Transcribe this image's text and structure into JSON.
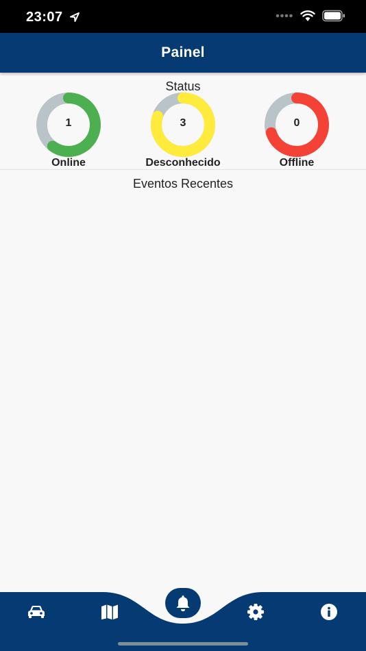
{
  "status_bar": {
    "time": "23:07",
    "icons": [
      "location-arrow-icon",
      "signal-dots-icon",
      "wifi-icon",
      "battery-icon"
    ]
  },
  "app_bar": {
    "title": "Painel"
  },
  "status": {
    "heading": "Status",
    "items": [
      {
        "label": "Online",
        "value": "1",
        "color": "#4caf50",
        "fraction": 0.6
      },
      {
        "label": "Desconhecido",
        "value": "3",
        "color": "#ffeb3b",
        "fraction": 0.8
      },
      {
        "label": "Offline",
        "value": "0",
        "color": "#f44336",
        "fraction": 0.7
      }
    ],
    "track_color": "#b8c4c8"
  },
  "events": {
    "heading": "Eventos Recentes"
  },
  "bottom_nav": {
    "items": [
      "car-icon",
      "map-icon",
      "bell-icon",
      "gear-icon",
      "info-icon"
    ],
    "active": "bell-icon",
    "color": "#053a73"
  }
}
